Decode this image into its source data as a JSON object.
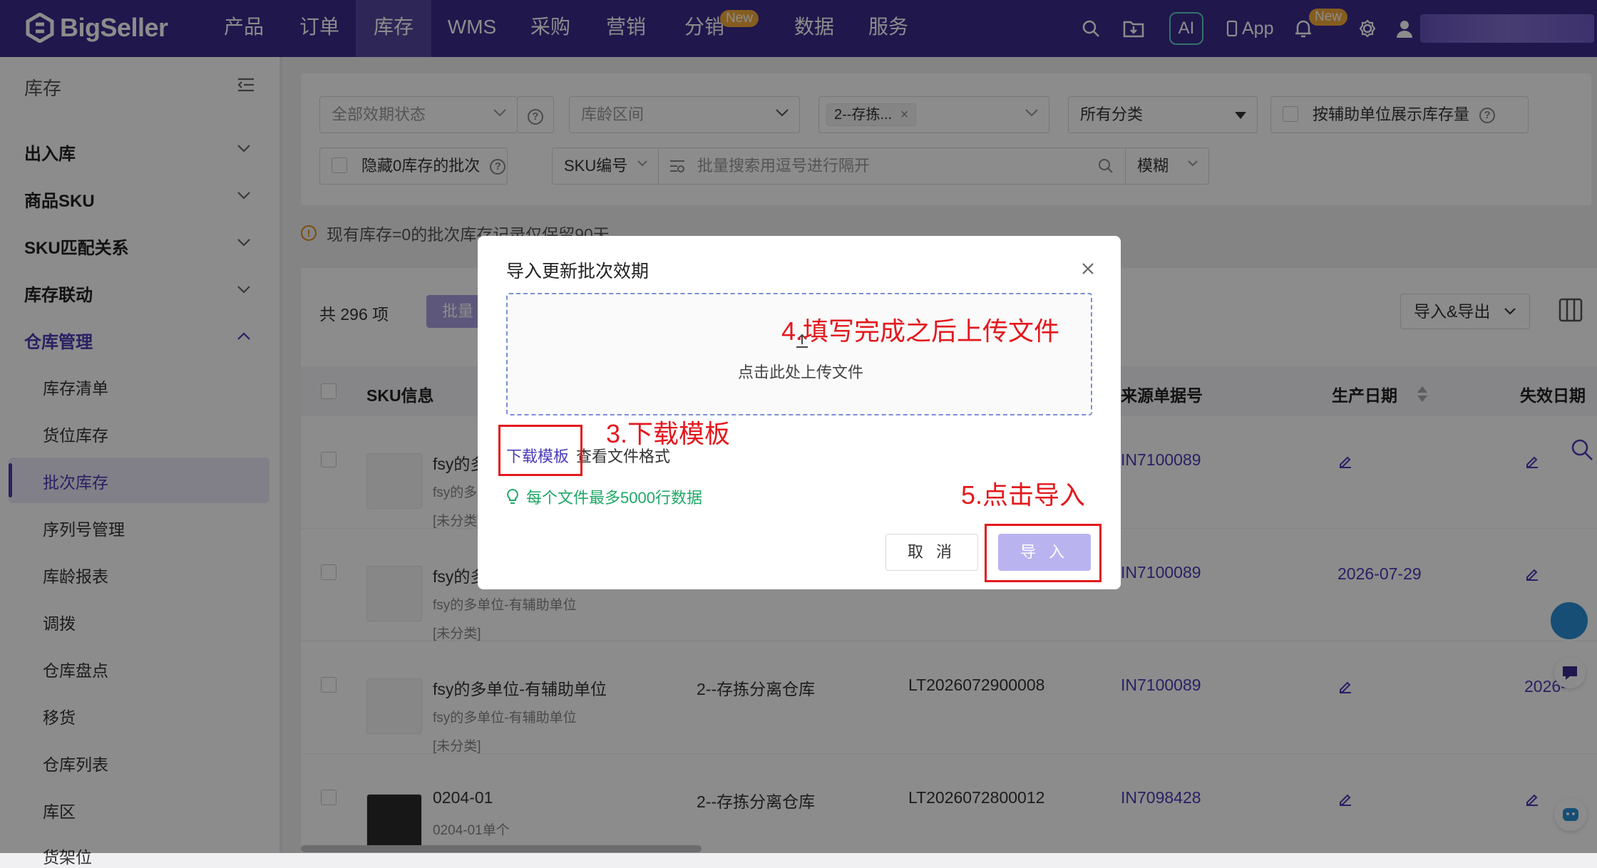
{
  "nav": {
    "brand": "BigSeller",
    "items": [
      {
        "label": "产品"
      },
      {
        "label": "订单"
      },
      {
        "label": "库存"
      },
      {
        "label": "WMS"
      },
      {
        "label": "采购"
      },
      {
        "label": "营销"
      },
      {
        "label": "分销",
        "badge": "New"
      },
      {
        "label": "数据"
      },
      {
        "label": "服务"
      }
    ],
    "active_index": 2,
    "ai_label": "AI",
    "app_label": "App",
    "bell_badge": "New"
  },
  "sidebar": {
    "title": "库存",
    "groups": [
      {
        "label": "出入库"
      },
      {
        "label": "商品SKU"
      },
      {
        "label": "SKU匹配关系"
      },
      {
        "label": "库存联动"
      },
      {
        "label": "仓库管理"
      }
    ],
    "items": [
      {
        "label": "库存清单"
      },
      {
        "label": "货位库存"
      },
      {
        "label": "批次库存"
      },
      {
        "label": "序列号管理"
      },
      {
        "label": "库龄报表"
      },
      {
        "label": "调拨"
      },
      {
        "label": "仓库盘点"
      },
      {
        "label": "移货"
      },
      {
        "label": "仓库列表"
      },
      {
        "label": "库区"
      },
      {
        "label": "货架位"
      }
    ],
    "active_item": "批次库存"
  },
  "filters": {
    "expiry_status_placeholder": "全部效期状态",
    "age_range_placeholder": "库龄区间",
    "warehouse_tag": "2--存拣...",
    "category": "所有分类",
    "aux_unit_label": "按辅助单位展示库存量",
    "hide_zero_label": "隐藏0库存的批次",
    "search_field": "SKU编号",
    "search_placeholder": "批量搜索用逗号进行隔开",
    "match_mode": "模糊"
  },
  "notice": "现有库存=0的批次库存记录仅保留90天",
  "toolbar": {
    "total": "共 296 项",
    "batch_label": "批量",
    "import_export": "导入&导出"
  },
  "table": {
    "headers": {
      "sku": "SKU信息",
      "source": "来源单据号",
      "prod_date": "生产日期",
      "exp_date": "失效日期"
    },
    "rows": [
      {
        "name": "fsy的多",
        "sub": "fsy的多",
        "cat": "[未分类]",
        "warehouse": "",
        "batch": "",
        "source": "IN7100089",
        "prod": "",
        "exp": ""
      },
      {
        "name": "fsy的多",
        "sub": "fsy的多单位-有辅助单位",
        "cat": "[未分类]",
        "warehouse": "",
        "batch": "",
        "source": "IN7100089",
        "prod": "2026-07-29",
        "exp": ""
      },
      {
        "name": "fsy的多单位-有辅助单位",
        "sub": "fsy的多单位-有辅助单位",
        "cat": "[未分类]",
        "warehouse": "2--存拣分离仓库",
        "batch": "LT2026072900008",
        "source": "IN7100089",
        "prod": "",
        "exp": "2026-"
      },
      {
        "name": "0204-01",
        "sub": "0204-01单个",
        "cat": "",
        "warehouse": "2--存拣分离仓库",
        "batch": "LT2026072800012",
        "source": "IN7098428",
        "prod": "",
        "exp": ""
      }
    ]
  },
  "modal": {
    "title": "导入更新批次效期",
    "upload_text": "点击此处上传文件",
    "download_template": "下载模板",
    "view_format": "查看文件格式",
    "tip": "每个文件最多5000行数据",
    "cancel": "取 消",
    "import": "导 入"
  },
  "annotations": {
    "step3": "3.下载模板",
    "step4": "4.填写完成之后上传文件",
    "step5": "5.点击导入",
    "color": "#e3191e"
  },
  "colors": {
    "nav_bg": "#3b2a8d",
    "accent": "#4a3bb5",
    "tip_green": "#1ea866",
    "import_disabled": "#b9b3f0"
  }
}
